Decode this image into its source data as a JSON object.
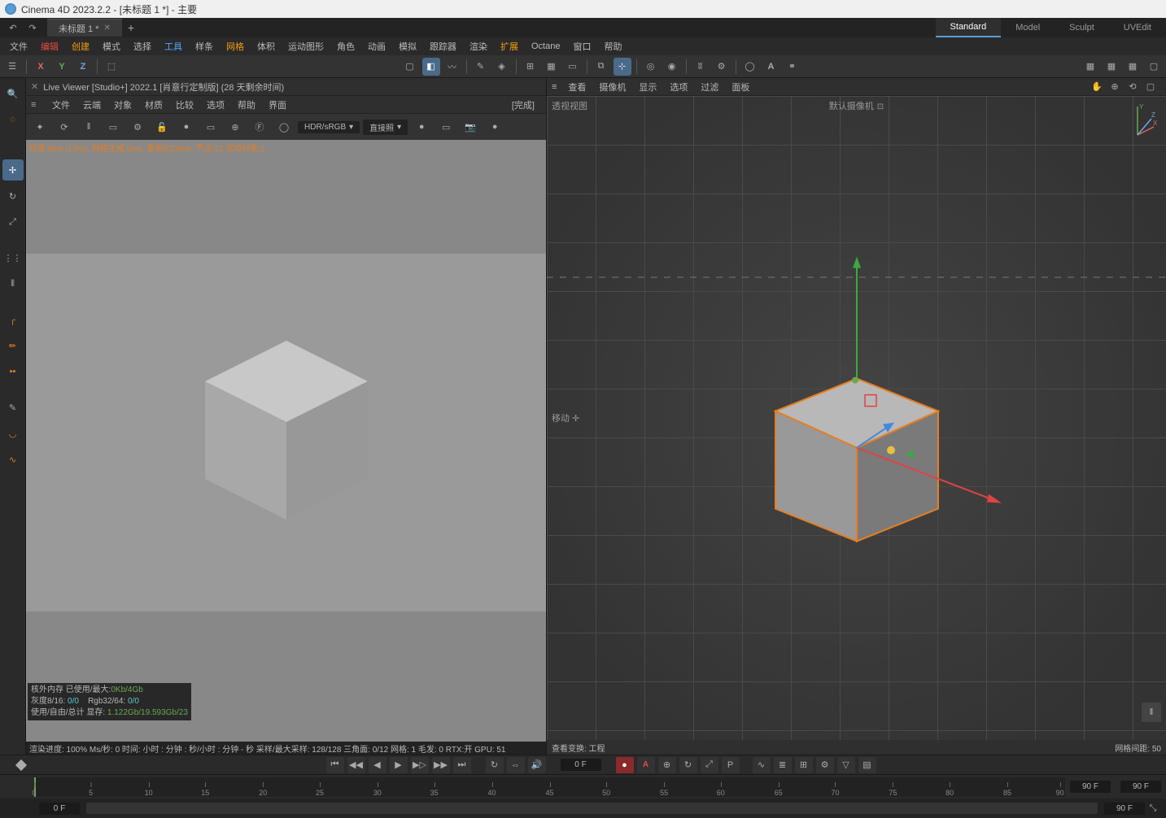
{
  "titlebar": {
    "text": "Cinema 4D 2023.2.2 - [未标题 1 *] - 主要"
  },
  "tab": {
    "label": "未标题 1 *"
  },
  "layout_tabs": {
    "standard": "Standard",
    "model": "Model",
    "sculpt": "Sculpt",
    "uvedit": "UVEdit"
  },
  "menu": {
    "items": [
      "文件",
      "编辑",
      "创建",
      "模式",
      "选择",
      "工具",
      "样条",
      "网格",
      "体积",
      "运动图形",
      "角色",
      "动画",
      "模拟",
      "跟踪器",
      "渲染",
      "扩展",
      "Octane",
      "窗口",
      "帮助"
    ]
  },
  "axis": {
    "x": "X",
    "y": "Y",
    "z": "Z"
  },
  "liveviewer": {
    "title": "Live Viewer [Studio+] 2022.1 [肖意行定制版] (28 天剩余时间)",
    "menu": [
      "文件",
      "云端",
      "对象",
      "材质",
      "比较",
      "选项",
      "帮助",
      "界面"
    ],
    "done": "[完成]",
    "hdr": "HDR/sRGB",
    "light": "直接照",
    "status": "检查:0ms./17ms. 网格生成:0ms. 更新[C]:0ms. 节点:12 活动对象:1",
    "mem1": "核外内存 已使用/最大:",
    "mem1v": "0Kb/4Gb",
    "mem2a": "灰度8/16: ",
    "mem2av": "0/0",
    "mem2b": "Rgb32/64: ",
    "mem2bv": "0/0",
    "mem3": "使用/自由/总计 显存: ",
    "mem3v": "1.122Gb/19.593Gb/23",
    "stat": "渲染进度: 100%   Ms/秒: 0   时间: 小时 : 分钟 : 秒/小时 : 分钟 - 秒   采样/最大采样: 128/128   三角面: 0/12   网格: 1   毛发: 0   RTX:开   GPU:   51"
  },
  "viewport": {
    "menu": [
      "查看",
      "摄像机",
      "显示",
      "选项",
      "过滤",
      "面板"
    ],
    "label_tl": "透视视图",
    "label_tc": "默认摄像机",
    "camlock": "⊡",
    "label_ml": "移动 ✛",
    "status_l": "查看变换: 工程",
    "status_r": "网格间距: 50",
    "axis": {
      "x": "X",
      "y": "Y",
      "z": "Z"
    }
  },
  "timeline": {
    "ticks": [
      "0",
      "5",
      "10",
      "15",
      "20",
      "25",
      "30",
      "35",
      "40",
      "45",
      "50",
      "55",
      "60",
      "65",
      "70",
      "75",
      "80",
      "85",
      "90"
    ],
    "frame": "0 F",
    "frame2": "90 F",
    "start": "0 F",
    "end": "90 F",
    "auto": "A"
  }
}
